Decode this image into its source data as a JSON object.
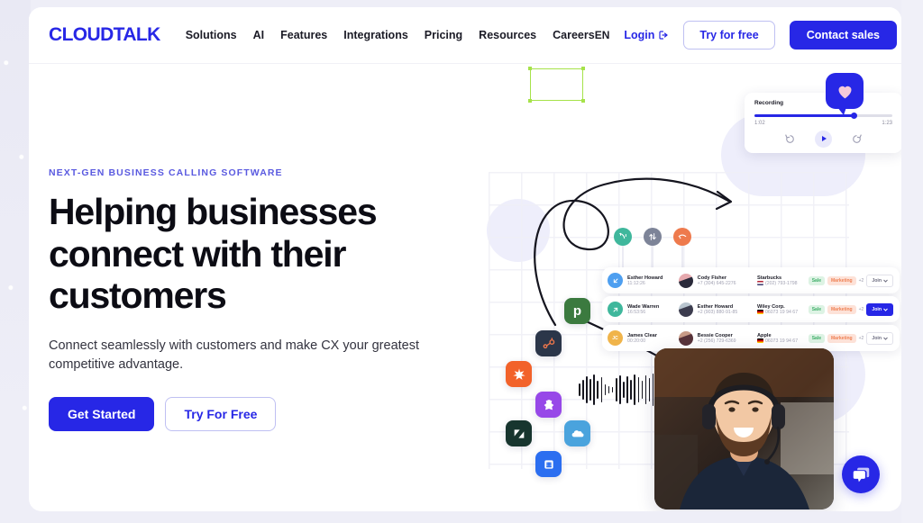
{
  "brand": {
    "logo_text": "CLOUDTALK",
    "primary_blue": "#2727e6",
    "eyebrow_blue": "#5a5ae0",
    "page_bg": "#eeeef7"
  },
  "navbar": {
    "links": [
      {
        "label": "Solutions"
      },
      {
        "label": "AI"
      },
      {
        "label": "Features"
      },
      {
        "label": "Integrations"
      },
      {
        "label": "Pricing"
      },
      {
        "label": "Resources"
      },
      {
        "label": "Careers"
      }
    ],
    "language": "EN",
    "login_label": "Login",
    "try_free_label": "Try for free",
    "contact_sales_label": "Contact sales"
  },
  "hero": {
    "eyebrow": "NEXT-GEN BUSINESS CALLING SOFTWARE",
    "title": "Helping businesses connect with their customers",
    "subtitle": "Connect seamlessly with customers and make CX your greatest competitive advantage.",
    "cta_primary": "Get Started",
    "cta_secondary": "Try For Free"
  },
  "recording_card": {
    "label": "Recording",
    "time_current": "1:02",
    "time_total": "1:23",
    "progress_percent": 72,
    "controls": {
      "rewind_label": "10",
      "forward_label": "10",
      "play_label": "play"
    }
  },
  "contacts": {
    "rows": [
      {
        "direction": "inbound",
        "caller_name": "Esther Howard",
        "caller_time": "11:12:26",
        "contact_name": "Cody Fisher",
        "contact_phone": "+7 (304) 645-2276",
        "company": "Starbucks",
        "company_flag": "us",
        "company_phone": "(202) 793-1798",
        "tags": [
          "Sale",
          "Marketing"
        ],
        "tag_more": "+2",
        "join_label": "Join",
        "join_active": false
      },
      {
        "direction": "outbound",
        "caller_name": "Wade Warren",
        "caller_time": "16:53:56",
        "contact_name": "Esther Howard",
        "contact_phone": "+2 (903) 880-91-85",
        "company": "Wiley Corp.",
        "company_flag": "de",
        "company_phone": "06073 19 94 67",
        "tags": [
          "Sale",
          "Marketing"
        ],
        "tag_more": "+2",
        "join_label": "Join",
        "join_active": true
      },
      {
        "direction": "missed",
        "caller_name": "James Clear",
        "caller_time": "00:20:00",
        "contact_name": "Bessie Cooper",
        "contact_phone": "+2 (256) 729-6369",
        "company": "Apple",
        "company_flag": "de",
        "company_phone": "06073 19 94 67",
        "tags": [
          "Sale",
          "Marketing"
        ],
        "tag_more": "+2",
        "join_label": "Join",
        "join_active": false
      }
    ]
  },
  "integrations": [
    {
      "name": "pipedrive",
      "glyph": "p",
      "color": "#3b7a3f"
    },
    {
      "name": "hubspot",
      "glyph": "",
      "color": "#2b3649"
    },
    {
      "name": "zapier",
      "glyph": "✳",
      "color": "#f2622a"
    },
    {
      "name": "intercom",
      "glyph": "",
      "color": "#9748e8"
    },
    {
      "name": "zendesk",
      "glyph": "z",
      "color": "#17352e"
    },
    {
      "name": "salesforce",
      "glyph": "",
      "color": "#4aa3dd"
    },
    {
      "name": "aircall",
      "glyph": "",
      "color": "#2b6ef0"
    }
  ],
  "status_icons": [
    {
      "name": "call-connected",
      "color": "#3fb79c"
    },
    {
      "name": "call-transfer",
      "color": "#7d8498"
    },
    {
      "name": "call-ended",
      "color": "#ee7a4d"
    }
  ],
  "waveform": {
    "bars": [
      14,
      22,
      30,
      24,
      34,
      20,
      28,
      12,
      8,
      6,
      26,
      32,
      18,
      30,
      22,
      34,
      28,
      20,
      32,
      26,
      36,
      30,
      24,
      34,
      20,
      28,
      22,
      16
    ],
    "selection_color": "#a6e24a"
  },
  "agent_photo": {
    "alt": "smiling support agent wearing a headset"
  },
  "chat_widget": {
    "label": "open-chat"
  }
}
